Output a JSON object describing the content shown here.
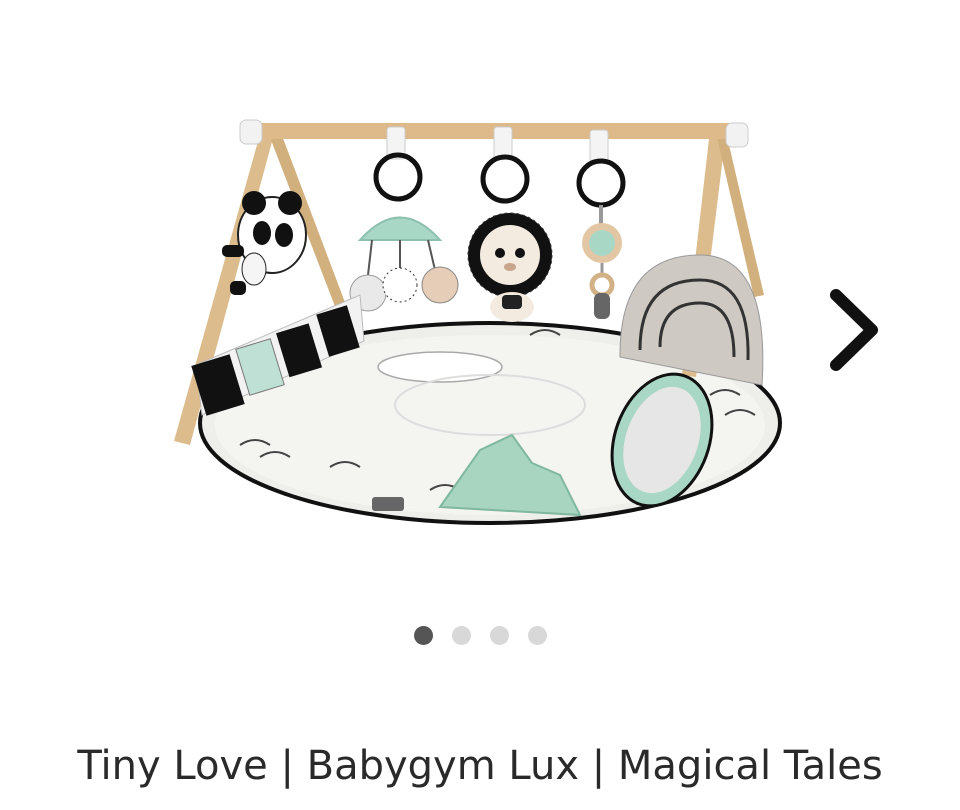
{
  "carousel": {
    "image_alt": "Tiny Love Babygym Lux Magical Tales play gym",
    "next_icon": "chevron-right-icon",
    "slide_count": 4,
    "active_slide": 1
  },
  "product": {
    "title": "Tiny Love | Babygym Lux | Magical Tales"
  },
  "colors": {
    "wood": "#d9b98a",
    "mint": "#a9d7c6",
    "mat": "#eeeeea",
    "dot_active": "#555555",
    "dot_inactive": "#d8d8d8",
    "arrow": "#111111"
  }
}
